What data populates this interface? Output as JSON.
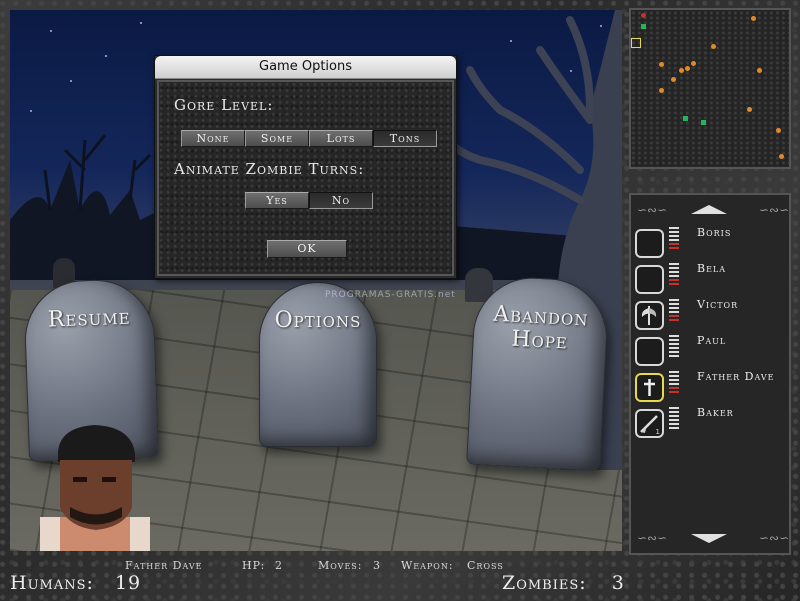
{
  "dialog": {
    "title": "Game Options",
    "gore_label": "Gore Level:",
    "gore_options": [
      "None",
      "Some",
      "Lots",
      "Tons"
    ],
    "gore_selected": "Tons",
    "animate_label": "Animate Zombie Turns:",
    "animate_options": [
      "Yes",
      "No"
    ],
    "animate_selected": "No",
    "ok_label": "OK"
  },
  "tombstones": {
    "resume": "Resume",
    "options": "Options",
    "abandon_line1": "Abandon",
    "abandon_line2": "Hope"
  },
  "watermark": "PROGRAMAS-GRATIS.net",
  "roster": {
    "members": [
      {
        "name": "Boris",
        "icon": "empty-slot",
        "wounds": 2
      },
      {
        "name": "Bela",
        "icon": "empty-slot",
        "wounds": 2
      },
      {
        "name": "Victor",
        "icon": "axe-icon",
        "wounds": 2
      },
      {
        "name": "Paul",
        "icon": "empty-slot",
        "wounds": 0
      },
      {
        "name": "Father Dave",
        "icon": "cross-icon",
        "wounds": 2,
        "active": true
      },
      {
        "name": "Baker",
        "icon": "rifle-icon",
        "wounds": 0,
        "ammo": "1"
      }
    ]
  },
  "status": {
    "character": "Father Dave",
    "hp_label": "HP:",
    "hp": "2",
    "moves_label": "Moves:",
    "moves": "3",
    "weapon_label": "Weapon:",
    "weapon": "Cross"
  },
  "counts": {
    "humans_label": "Humans:",
    "humans": "19",
    "zombies_label": "Zombies:",
    "zombies": "3"
  },
  "colors": {
    "human_marker": "#e08a2a",
    "zombie_marker": "#22b55a",
    "enemy_marker": "#d42a2a",
    "active_slot": "#e8d94a"
  }
}
